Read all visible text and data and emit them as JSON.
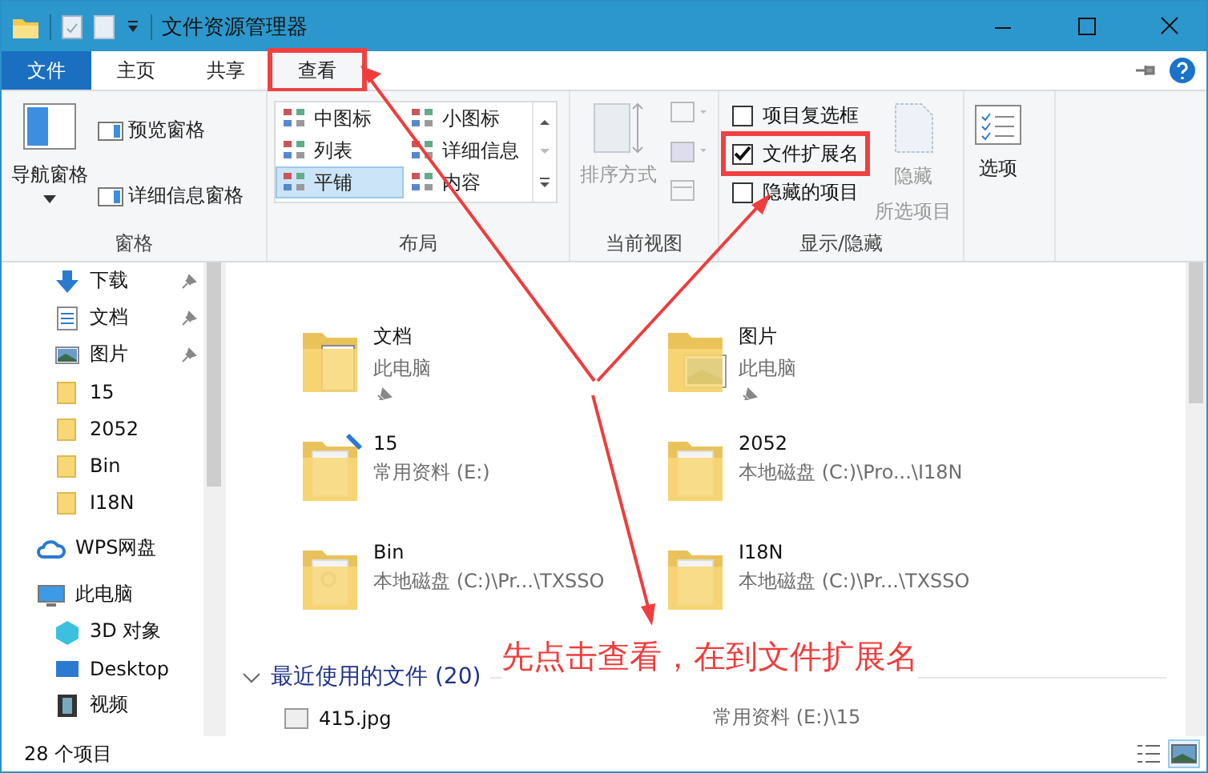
{
  "window": {
    "title": "文件资源管理器"
  },
  "ribbon_tabs": [
    {
      "label": "文件",
      "kind": "file",
      "selected": false,
      "highlighted": false
    },
    {
      "label": "主页",
      "kind": "tab",
      "selected": false,
      "highlighted": false
    },
    {
      "label": "共享",
      "kind": "tab",
      "selected": false,
      "highlighted": false
    },
    {
      "label": "查看",
      "kind": "tab",
      "selected": true,
      "highlighted": true
    }
  ],
  "panes": {
    "label": "窗格",
    "nav_pane": "导航窗格",
    "preview_pane": "预览窗格",
    "details_pane": "详细信息窗格"
  },
  "layout": {
    "label": "布局",
    "options": [
      {
        "label": "中图标",
        "selected": false
      },
      {
        "label": "列表",
        "selected": false
      },
      {
        "label": "平铺",
        "selected": true
      },
      {
        "label": "小图标",
        "selected": false
      },
      {
        "label": "详细信息",
        "selected": false
      },
      {
        "label": "内容",
        "selected": false
      }
    ]
  },
  "current_view": {
    "label": "当前视图",
    "sort": "排序方式"
  },
  "show_hide": {
    "label": "显示/隐藏",
    "checkboxes": [
      {
        "label": "项目复选框",
        "checked": false,
        "highlighted": false
      },
      {
        "label": "文件扩展名",
        "checked": true,
        "highlighted": true
      },
      {
        "label": "隐藏的项目",
        "checked": false,
        "highlighted": false
      }
    ],
    "hide_selected": [
      "隐藏",
      "所选项目"
    ]
  },
  "options": {
    "label": "选项"
  },
  "nav": {
    "quick": [
      {
        "label": "下载",
        "kind": "download",
        "pinned": true
      },
      {
        "label": "文档",
        "kind": "document",
        "pinned": true
      },
      {
        "label": "图片",
        "kind": "picture",
        "pinned": true
      },
      {
        "label": "15",
        "kind": "folder",
        "pinned": false
      },
      {
        "label": "2052",
        "kind": "folder",
        "pinned": false
      },
      {
        "label": "Bin",
        "kind": "folder",
        "pinned": false
      },
      {
        "label": "I18N",
        "kind": "folder",
        "pinned": false
      }
    ],
    "roots": [
      {
        "label": "WPS网盘",
        "kind": "cloud"
      },
      {
        "label": "此电脑",
        "kind": "computer",
        "children": [
          {
            "label": "3D 对象",
            "kind": "cube"
          },
          {
            "label": "Desktop",
            "kind": "desktop"
          },
          {
            "label": "视频",
            "kind": "film"
          }
        ]
      }
    ]
  },
  "tiles": [
    {
      "name": "文档",
      "location": "此电脑",
      "pinned": true,
      "kind": "documents"
    },
    {
      "name": "图片",
      "location": "此电脑",
      "pinned": true,
      "kind": "pictures"
    },
    {
      "name": "15",
      "location": "常用资料 (E:)",
      "pinned": false,
      "kind": "synced"
    },
    {
      "name": "2052",
      "location": "本地磁盘 (C:)\\Pro...\\I18N",
      "pinned": false,
      "kind": "files"
    },
    {
      "name": "Bin",
      "location": "本地磁盘 (C:)\\Pr...\\TXSSO",
      "pinned": false,
      "kind": "gears"
    },
    {
      "name": "I18N",
      "location": "本地磁盘 (C:)\\Pr...\\TXSSO",
      "pinned": false,
      "kind": "files"
    }
  ],
  "recent": {
    "title": "最近使用的文件 (20)",
    "expanded": true,
    "items": [
      {
        "name": "415.jpg",
        "location": "常用资料 (E:)\\15"
      }
    ]
  },
  "status_bar": {
    "count": "28 个项目",
    "views": [
      {
        "kind": "details",
        "selected": false
      },
      {
        "kind": "large",
        "selected": true
      }
    ]
  },
  "annotation": {
    "text": "先点击查看，在到文件扩展名"
  }
}
